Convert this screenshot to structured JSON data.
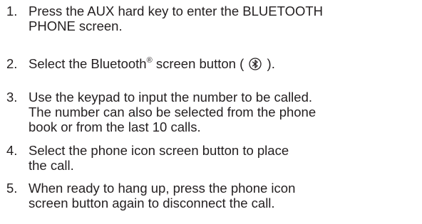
{
  "steps": [
    {
      "number": "1.",
      "lines": [
        "Press the AUX hard key to enter the BLUETOOTH",
        "PHONE screen."
      ]
    },
    {
      "number": "2.",
      "text_before": "Select the Bluetooth",
      "superscript": "®",
      "text_middle": " screen button ( ",
      "icon": "bluetooth-icon",
      "text_after": " )."
    },
    {
      "number": "3.",
      "lines": [
        "Use the keypad to input the number to be called.",
        "The number can also be selected from the phone",
        "book or from the last 10 calls."
      ]
    },
    {
      "number": "4.",
      "lines": [
        "Select the phone icon screen button to place",
        "the call."
      ]
    },
    {
      "number": "5.",
      "lines": [
        "When ready to hang up, press the phone icon",
        "screen button again to disconnect the call."
      ]
    }
  ],
  "colors": {
    "text": "#231f20",
    "background": "#ffffff"
  }
}
